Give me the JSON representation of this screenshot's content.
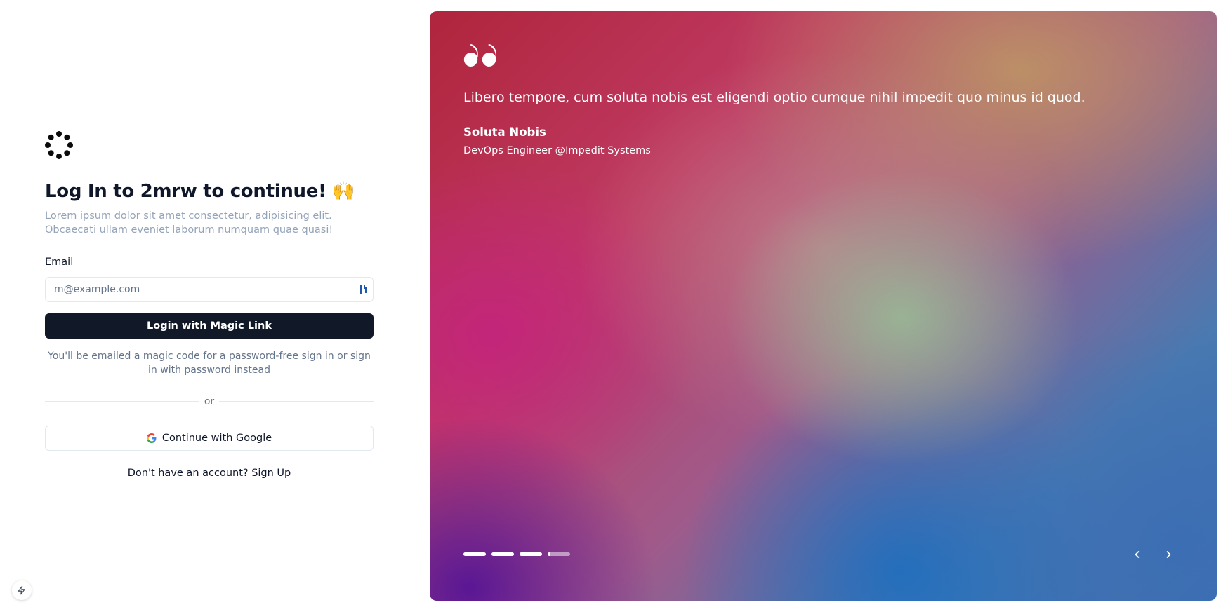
{
  "login": {
    "title": "Log In to 2mrw to continue! 🙌",
    "subtitle": "Lorem ipsum dolor sit amet consectetur, adipisicing elit. Obcaecati ullam eveniet laborum numquam quae quasi!",
    "email_label": "Email",
    "email_placeholder": "m@example.com",
    "email_value": "",
    "magic_link_button": "Login with Magic Link",
    "hint_text": "You'll be emailed a magic code for a password-free sign in or ",
    "hint_link": "sign in with password instead",
    "divider_text": "or",
    "google_button": "Continue with Google",
    "signup_text": "Don't have an account? ",
    "signup_link": "Sign Up"
  },
  "testimonial": {
    "quote": "Libero tempore, cum soluta nobis est eligendi optio cumque nihil impedit quo minus id quod.",
    "author_name": "Soluta Nobis",
    "author_role": "DevOps Engineer @Impedit Systems",
    "slide_count": 4,
    "active_slide": 4,
    "active_slide_progress": 0.1
  },
  "icons": {
    "logo": "dots-ring-logo-icon",
    "quote": "quote-icon",
    "google": "google-icon",
    "password_manager": "password-manager-icon",
    "prev": "chevron-left-icon",
    "next": "chevron-right-icon",
    "corner": "lightning-icon"
  },
  "colors": {
    "primary_button": "#111827",
    "muted_text": "#64748b",
    "border": "#e2e8f0"
  }
}
